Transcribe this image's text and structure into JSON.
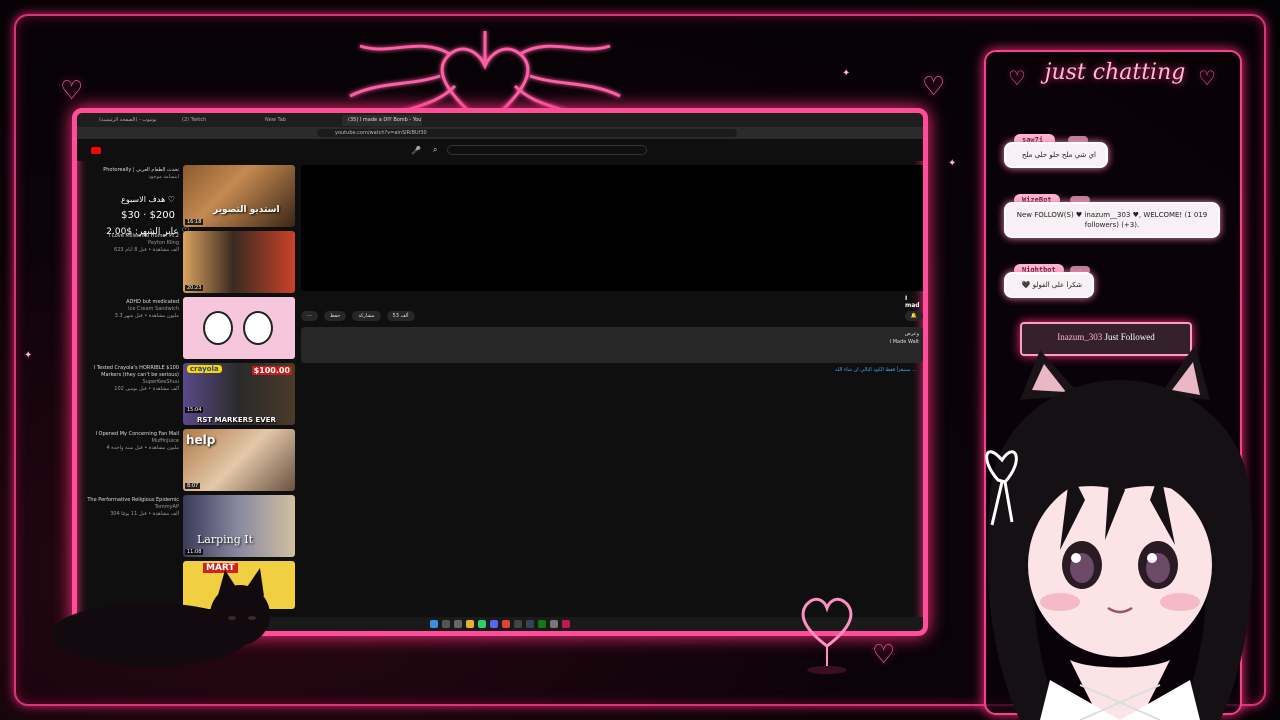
{
  "browser": {
    "tabs": [
      {
        "label": "(الصفحة الرئيسية) - يوتيوب",
        "active": false
      },
      {
        "label": "(2) Twitch",
        "active": false
      },
      {
        "label": "New Tab",
        "active": false
      },
      {
        "label": "(35) I made a DIY Bomb - YouT...",
        "active": true
      }
    ],
    "url": "youtube.com/watch?v=ainSIRiBUf30"
  },
  "donation": {
    "goal_label": "هدف الاسبوع ♡",
    "goal_range": "$30 · $200",
    "month_label": "عابر الشهر: $2.00 ♡"
  },
  "recommendations": [
    {
      "title": "Photoreally | تحدث الطعام العربي",
      "channel": "ابتسامة موجود",
      "meta": "304",
      "duration": "16:18"
    },
    {
      "title": "I Love Millennial Humor Pt.2",
      "channel": "Payton Kling",
      "meta": "623 ألف مشاهدة • قبل 8 أيام",
      "duration": "20:23"
    },
    {
      "title": "ADHD but medicated",
      "channel": "Ice Cream Sandwich",
      "meta": "3.3 مليون مشاهدة • قبل شهر",
      "duration": ""
    },
    {
      "title": "I Tested Crayola's HORRIBLE $100 Markers (they can't be serious)",
      "channel": "SuperKeeShuu",
      "meta": "102 ألف مشاهدة • قبل يومين",
      "duration": "15:04"
    },
    {
      "title": "I Opened My Concerning Fan Mail",
      "channel": "MuffinJuice",
      "meta": "4 مليون مشاهدة • قبل سنة واحدة",
      "duration": "8:07"
    },
    {
      "title": "The Performative Religious Epidemic",
      "channel": "TommyAP",
      "meta": "304 ألف مشاهدة • قبل 11 يومًا",
      "duration": "11:08"
    }
  ],
  "thumb_texts": {
    "t1": "استديو التصوير",
    "t4_price": "$100.00",
    "t4_brand": "crayola",
    "t4_caption": "RST MARKERS EVER",
    "t5": "help",
    "t6": "Larping It",
    "t7": "MART"
  },
  "video": {
    "title_fragment": "I mad",
    "likes": "53 ألف",
    "share_label": "مشاركة",
    "save_label": "حفظ",
    "desc_line1": "وعرض",
    "desc_line2": "I Made Walt",
    "comment_link": "سينقرأ فقط الكود التالي ان شاء الله ..."
  },
  "chat": {
    "title": "just chatting",
    "messages": [
      {
        "user": "saw7i_",
        "text": "اي شي ملح حلو حلى ملح"
      },
      {
        "user": "WizeBot",
        "text": "New FOLLOW(S) ♥ inazum__303 ♥, WELCOME! (1 019 followers) (+3)."
      },
      {
        "user": "Nightbot",
        "text": "شكرا على الفولو 🖤"
      }
    ],
    "follow_alert_name": "Inazum_303",
    "follow_alert_text": "Just Followed"
  },
  "colors": {
    "neon_pink": "#ff3c8e",
    "bubble_bg": "#f8f0f4",
    "username_bg": "#ffb6cf"
  }
}
